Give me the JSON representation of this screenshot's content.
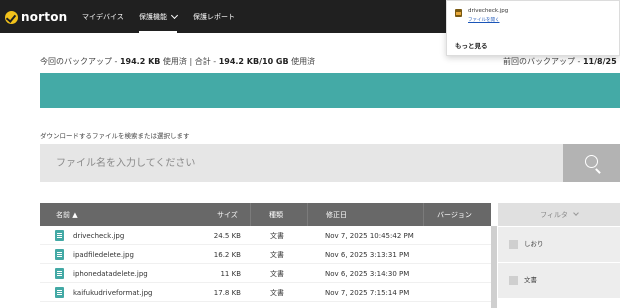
{
  "app": {
    "brand": "norton",
    "nav": [
      {
        "label": "マイデバイス"
      },
      {
        "label": "保護機能"
      },
      {
        "label": "保護レポート"
      }
    ]
  },
  "popup": {
    "file_name": "drivecheck.jpg",
    "open_link": "ファイルを開く",
    "more": "もっと見る"
  },
  "summary": {
    "backup_label": "今回のバックアップ -",
    "backup_size": "194.2 KB",
    "used_sep": "使用済 | 合計 -",
    "total": "194.2 KB/10 GB",
    "used_suffix": "使用済",
    "last_label": "前回のバックアップ -",
    "last_value": "11/8/25"
  },
  "search": {
    "label": "ダウンロードするファイルを検索または選択します",
    "placeholder": "ファイル名を入力してください"
  },
  "table": {
    "columns": {
      "name": "名前 ▲",
      "size": "サイズ",
      "type": "種類",
      "modified": "修正日",
      "version": "バージョン"
    },
    "rows": [
      {
        "name": "drivecheck.jpg",
        "size": "24.5 KB",
        "type": "文書",
        "modified": "Nov 7, 2025 10:45:42 PM",
        "version": ""
      },
      {
        "name": "ipadfiledelete.jpg",
        "size": "16.2 KB",
        "type": "文書",
        "modified": "Nov 6, 2025 3:13:31 PM",
        "version": ""
      },
      {
        "name": "iphonedatadelete.jpg",
        "size": "11 KB",
        "type": "文書",
        "modified": "Nov 6, 2025 3:14:30 PM",
        "version": ""
      },
      {
        "name": "kaifukudriveformat.jpg",
        "size": "17.8 KB",
        "type": "文書",
        "modified": "Nov 7, 2025 7:15:14 PM",
        "version": ""
      }
    ]
  },
  "filter": {
    "header": "フィルタ",
    "items": [
      {
        "label": "しおり"
      },
      {
        "label": "文書"
      }
    ]
  },
  "colors": {
    "topbar": "#202020",
    "accent_teal": "#44aaa6",
    "table_header": "#686868",
    "link": "#1a55b8"
  }
}
